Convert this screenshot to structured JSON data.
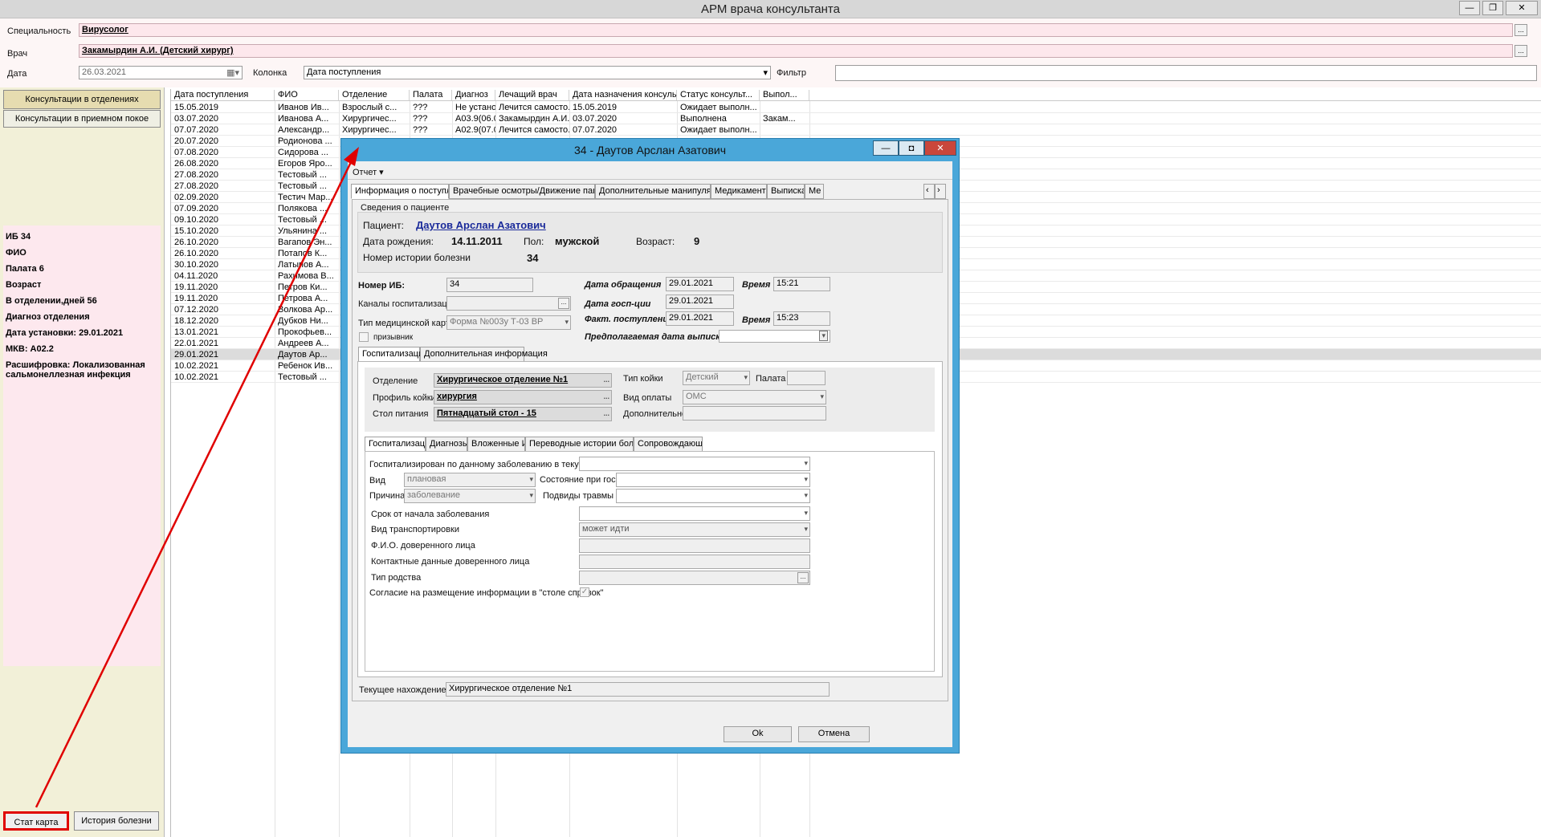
{
  "app": {
    "title": "АРМ врача консультанта",
    "win_min": "—",
    "win_max": "❐",
    "win_close": "✕"
  },
  "filters": {
    "spec_label": "Специальность",
    "spec_value": "Вирусолог",
    "doctor_label": "Врач",
    "doctor_value": "Закамырдин А.И. (Детский хирург)",
    "date_label": "Дата",
    "date_value": "26.03.2021",
    "column_label": "Колонка",
    "column_value": "Дата поступления",
    "filter_label": "Фильтр",
    "filter_value": ""
  },
  "sidebar": {
    "btn_dept": "Консультации в отделениях",
    "btn_reception": "Консультации в приемном покое",
    "info": {
      "ib": "ИБ 34",
      "fio": "ФИО",
      "ward": "Палата 6",
      "age": "Возраст",
      "days": "В отделении,дней 56",
      "diag": "Диагноз отделения",
      "date_set": "Дата установки: 29.01.2021",
      "mkb": "МКВ: A02.2",
      "decode": "Расшифровка: Локализованная сальмонеллезная инфекция"
    },
    "btn_stat": "Стат карта",
    "btn_history": "История болезни"
  },
  "grid": {
    "headers": [
      "Дата поступления",
      "ФИО",
      "Отделение",
      "Палата",
      "Диагноз",
      "Лечащий врач",
      "Дата назначения консульта...",
      "Статус консульт...",
      "Выпол..."
    ],
    "rows": [
      [
        "15.05.2019",
        "Иванов Ив...",
        "Взрослый с...",
        "???",
        "Не установ...",
        "Лечится самосто...",
        "15.05.2019",
        "Ожидает выполн...",
        ""
      ],
      [
        "03.07.2020",
        "Иванова А...",
        "Хирургичес...",
        "???",
        "A03.9(06.0...",
        "Закамырдин А.И...",
        "03.07.2020",
        "Выполнена",
        "Закам..."
      ],
      [
        "07.07.2020",
        "Александр...",
        "Хирургичес...",
        "???",
        "A02.9(07.0...",
        "Лечится самосто...",
        "07.07.2020",
        "Ожидает выполн...",
        ""
      ],
      [
        "20.07.2020",
        "Родионова ...",
        "",
        "",
        "",
        "",
        "",
        "",
        ""
      ],
      [
        "07.08.2020",
        "Сидорова ...",
        "",
        "",
        "",
        "",
        "",
        "",
        ""
      ],
      [
        "26.08.2020",
        "Егоров Яро...",
        "",
        "",
        "",
        "",
        "",
        "",
        ""
      ],
      [
        "27.08.2020",
        "Тестовый ...",
        "",
        "",
        "",
        "",
        "",
        "",
        ""
      ],
      [
        "27.08.2020",
        "Тестовый ...",
        "",
        "",
        "",
        "",
        "",
        "",
        ""
      ],
      [
        "02.09.2020",
        "Тестич Мар...",
        "",
        "",
        "",
        "",
        "",
        "",
        ""
      ],
      [
        "07.09.2020",
        "Полякова ...",
        "",
        "",
        "",
        "",
        "",
        "",
        ""
      ],
      [
        "09.10.2020",
        "Тестовый ...",
        "",
        "",
        "",
        "",
        "",
        "",
        ""
      ],
      [
        "15.10.2020",
        "Ульянина ...",
        "",
        "",
        "",
        "",
        "",
        "",
        ""
      ],
      [
        "26.10.2020",
        "Вагапов Эн...",
        "",
        "",
        "",
        "",
        "",
        "",
        ""
      ],
      [
        "26.10.2020",
        "Потапов К...",
        "",
        "",
        "",
        "",
        "",
        "",
        ""
      ],
      [
        "30.10.2020",
        "Латыпов А...",
        "",
        "",
        "",
        "",
        "",
        "",
        ""
      ],
      [
        "04.11.2020",
        "Рахимова В...",
        "",
        "",
        "",
        "",
        "",
        "",
        ""
      ],
      [
        "19.11.2020",
        "Петров Ки...",
        "",
        "",
        "",
        "",
        "",
        "",
        ""
      ],
      [
        "19.11.2020",
        "Петрова А...",
        "",
        "",
        "",
        "",
        "",
        "",
        ""
      ],
      [
        "07.12.2020",
        "Волкова Ар...",
        "",
        "",
        "",
        "",
        "",
        "",
        ""
      ],
      [
        "18.12.2020",
        "Дубков Ни...",
        "",
        "",
        "",
        "",
        "",
        "",
        ""
      ],
      [
        "13.01.2021",
        "Прокофьев...",
        "",
        "",
        "",
        "",
        "",
        "",
        ""
      ],
      [
        "22.01.2021",
        "Андреев А...",
        "",
        "",
        "",
        "",
        "",
        "",
        ""
      ],
      [
        "29.01.2021",
        "Даутов Ар...",
        "",
        "",
        "",
        "",
        "",
        "",
        ""
      ],
      [
        "10.02.2021",
        "Ребенок Ив...",
        "",
        "",
        "",
        "",
        "",
        "",
        ""
      ],
      [
        "10.02.2021",
        "Тестовый ...",
        "",
        "",
        "",
        "",
        "",
        "",
        ""
      ]
    ]
  },
  "dialog": {
    "title": "34 - Даутов Арслан Азатович",
    "btn_min": "—",
    "btn_max": "◘",
    "btn_close": "✕",
    "menu_report": "Отчет ▾",
    "tabs": [
      "Информация о поступлении",
      "Врачебные осмотры/Движение пациента",
      "Дополнительные манипуляции",
      "Медикаменты",
      "Выписка",
      "Ме"
    ],
    "patient_group": "Сведения о пациенте",
    "patient_label": "Пациент:",
    "patient_name": "Даутов Арслан Азатович",
    "dob_label": "Дата рождения:",
    "dob": "14.11.2011",
    "sex_label": "Пол:",
    "sex": "мужской",
    "age_label": "Возраст:",
    "age": "9",
    "history_label": "Номер истории болезни",
    "history_no": "34",
    "ib_label": "Номер ИБ:",
    "ib_value": "34",
    "channels_label": "Каналы госпитализации",
    "card_type_label": "Тип медицинской карты",
    "card_type": "Форма №003у Т-03 ВР",
    "conscript_label": "призывник",
    "visit_date_label": "Дата обращения",
    "visit_date": "29.01.2021",
    "time_label": "Время",
    "visit_time": "15:21",
    "hosp_date_label": "Дата госп-ции",
    "hosp_date": "29.01.2021",
    "fact_label": "Факт. поступление",
    "fact_date": "29.01.2021",
    "fact_time": "15:23",
    "discharge_label": "Предполагаемая дата выписки",
    "subtabs": [
      "Госпитализация",
      "Дополнительная информация"
    ],
    "dept_label": "Отделение",
    "dept": "Хирургическое отделение №1",
    "profile_label": "Профиль койки",
    "profile": "хирургия",
    "diet_label": "Стол питания",
    "diet": "Пятнадцатый стол - 15",
    "bed_type_label": "Тип койки",
    "bed_type": "Детский",
    "ward_label": "Палата",
    "pay_label": "Вид оплаты",
    "pay": "ОМС",
    "extra_label": "Дополнительно",
    "innertabs": [
      "Госпитализация",
      "Диагнозы",
      "Вложенные ИБ",
      "Переводные истории болезни",
      "Сопровождающие"
    ],
    "hosp_this_year_label": "Госпитализирован по данному заболеванию в текущем году",
    "kind_label": "Вид",
    "kind": "плановая",
    "state_label": "Состояние при госп.",
    "reason_label": "Причина",
    "reason": "заболевание",
    "injury_label": "Подвиды травмы",
    "onset_label": "Срок от начала заболевания",
    "transport_label": "Вид транспортировки",
    "transport": "может идти",
    "trustee_label": "Ф.И.О. доверенного лица",
    "contacts_label": "Контактные данные доверенного лица",
    "kinship_label": "Тип родства",
    "consent_label": "Согласие на размещение информации в \"столе справок\"",
    "location_label": "Текущее нахождение",
    "location": "Хирургическое отделение №1",
    "ok": "Ok",
    "cancel": "Отмена"
  },
  "colors": {
    "accent_red": "#e00000",
    "dialog_frame": "#4aa7d9",
    "pink_field": "#fde7ec"
  }
}
